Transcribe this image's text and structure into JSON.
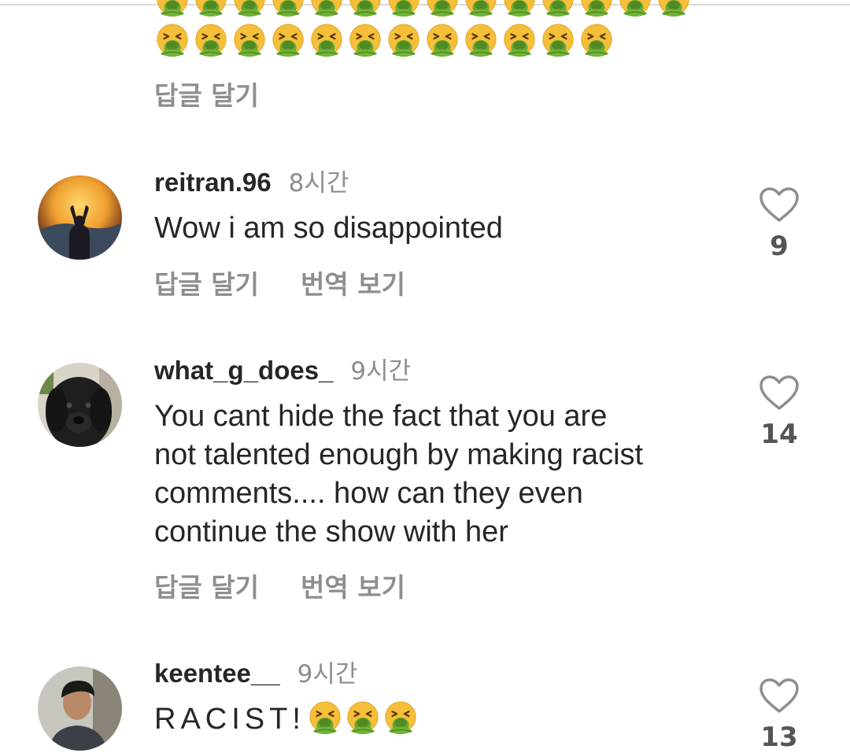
{
  "prior_comment": {
    "emoji_rows": [
      {
        "count": 14,
        "emoji": "nauseated-face"
      },
      {
        "count": 12,
        "emoji": "nauseated-face"
      }
    ],
    "reply_label": "답글 달기"
  },
  "comments": [
    {
      "username": "reitran.96",
      "time": "8시간",
      "text": "Wow i am so disappointed",
      "reply_label": "답글 달기",
      "translate_label": "번역 보기",
      "likes": "9",
      "avatar": "silhouette-sunset-avatar"
    },
    {
      "username": "what_g_does_",
      "time": "9시간",
      "text_lines": [
        "You cant hide the fact that you are",
        "not talented enough by making racist",
        "comments.... how can they even",
        "continue the show with her"
      ],
      "reply_label": "답글 달기",
      "translate_label": "번역 보기",
      "likes": "14",
      "avatar": "black-dog-avatar"
    },
    {
      "username": "keentee__",
      "time": "9시간",
      "text": "RACIST!",
      "text_emoji_count": 3,
      "likes": "13",
      "avatar": "person-photo-avatar"
    }
  ],
  "colors": {
    "text": "#262626",
    "muted": "#8e8e8e",
    "emoji_yellow": "#f7c23b",
    "emoji_green": "#5f9e2c"
  }
}
